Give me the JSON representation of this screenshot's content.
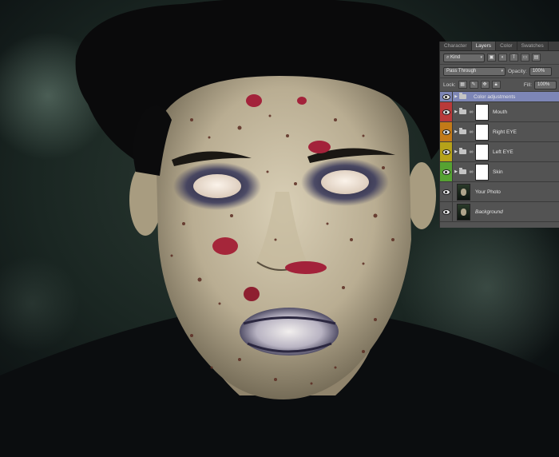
{
  "panel": {
    "tabs": [
      "Character",
      "Layers",
      "Color",
      "Swatches"
    ],
    "active_tab": "Layers",
    "filter_kind": "Kind",
    "blend_mode": "Pass Through",
    "opacity_label": "Opacity:",
    "opacity_value": "100%",
    "lock_label": "Lock:",
    "fill_label": "Fill:",
    "fill_value": "100%"
  },
  "layers": [
    {
      "name": "Color adjustments",
      "type": "group",
      "color": "#7d86b6",
      "selected": true
    },
    {
      "name": "Mouth",
      "type": "group-mask",
      "color": "#b93a3a"
    },
    {
      "name": "Right EYE",
      "type": "group-mask",
      "color": "#c27a18"
    },
    {
      "name": "Left EYE",
      "type": "group-mask",
      "color": "#b5a219"
    },
    {
      "name": "Skin",
      "type": "group-mask",
      "color": "#56a232"
    },
    {
      "name": "Your Photo",
      "type": "pixel",
      "color": ""
    },
    {
      "name": "Background",
      "type": "pixel",
      "color": "",
      "italic": true
    }
  ],
  "icons": {
    "eye": "visibility-eye-icon",
    "folder": "folder-icon",
    "link": "chain-link-icon",
    "lock": "lock-icon"
  }
}
